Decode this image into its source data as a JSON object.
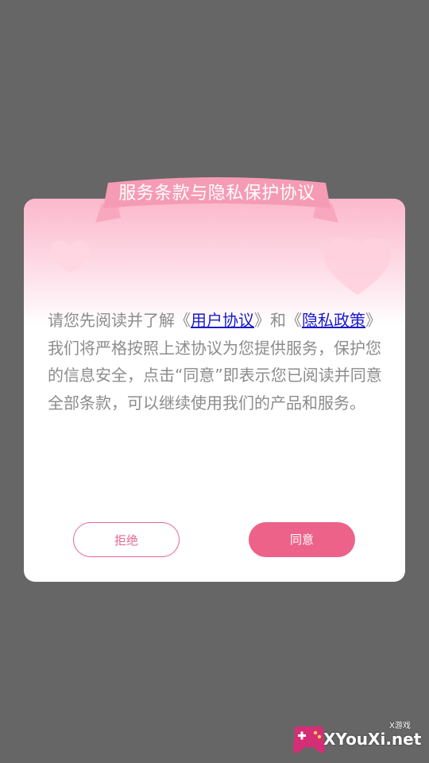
{
  "dialog": {
    "title": "服务条款与隐私保护协议",
    "content": {
      "intro": "请您先阅读并了解《",
      "user_agreement_link": "用户协议",
      "middle": "》和《",
      "privacy_link": "隐私政策",
      "rest": "》我们将严格按照上述协议为您提供服务，保护您的信息安全，点击“同意”即表示您已阅读并同意全部条款，可以继续使用我们的产品和服务。"
    },
    "buttons": {
      "reject": "拒绝",
      "agree": "同意"
    }
  },
  "watermark": {
    "text": "XYouXi.net",
    "small": "X游戏"
  },
  "colors": {
    "overlay": "#666666",
    "accent": "#ec6289",
    "link": "#1a1acc"
  },
  "icons": {
    "heart_left": "heart-icon",
    "heart_right": "heart-icon",
    "logo": "gamepad-logo-icon"
  }
}
